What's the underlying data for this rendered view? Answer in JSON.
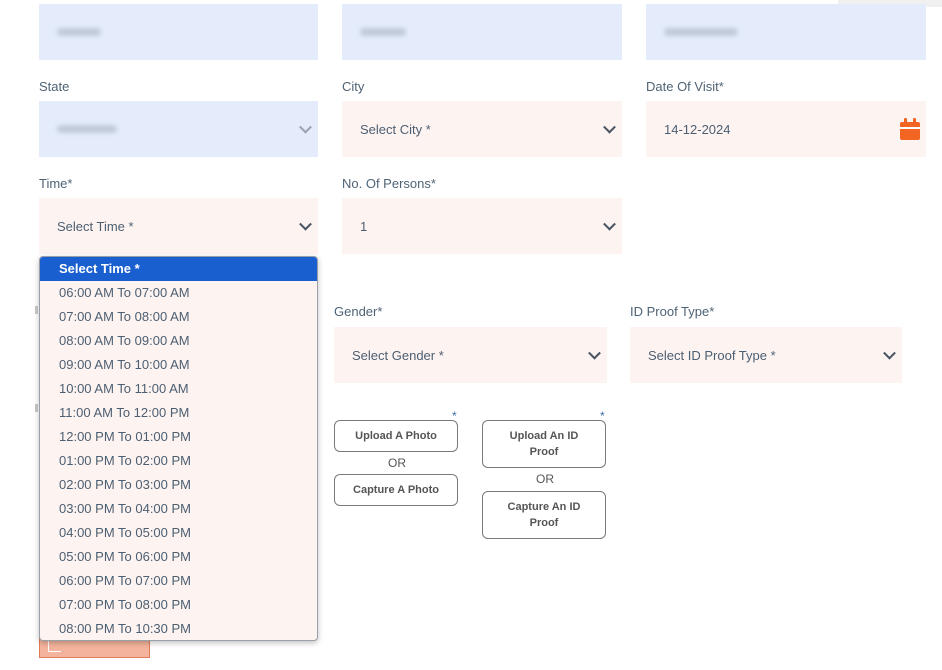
{
  "top_row": {
    "fields": [
      {
        "value": ""
      },
      {
        "value": ""
      },
      {
        "value": ""
      }
    ]
  },
  "labels": {
    "state": "State",
    "city": "City",
    "date_of_visit": "Date Of Visit*",
    "time": "Time*",
    "persons": "No. Of Persons*",
    "gender": "Gender*",
    "id_proof_type": "ID Proof Type*"
  },
  "fields": {
    "state_value": "",
    "city_value": "Select City *",
    "date_value": "14-12-2024",
    "time_value": "Select Time *",
    "persons_value": "1",
    "gender_value": "Select Gender *",
    "id_proof_value": "Select ID Proof Type *"
  },
  "uploads": {
    "photo_star": "*",
    "upload_photo": "Upload A Photo",
    "or_1": "OR",
    "capture_photo": "Capture A Photo",
    "id_star": "*",
    "upload_id": "Upload An ID Proof",
    "or_2": "OR",
    "capture_id": "Capture An ID Proof"
  },
  "time_options": [
    "Select Time *",
    "06:00 AM To 07:00 AM",
    "07:00 AM To 08:00 AM",
    "08:00 AM To 09:00 AM",
    "09:00 AM To 10:00 AM",
    "10:00 AM To 11:00 AM",
    "11:00 AM To 12:00 PM",
    "12:00 PM To 01:00 PM",
    "01:00 PM To 02:00 PM",
    "02:00 PM To 03:00 PM",
    "03:00 PM To 04:00 PM",
    "04:00 PM To 05:00 PM",
    "05:00 PM To 06:00 PM",
    "06:00 PM To 07:00 PM",
    "07:00 PM To 08:00 PM",
    "08:00 PM To 10:30 PM"
  ],
  "selected_time_index": 0,
  "icons": {
    "calendar": "calendar-icon",
    "chevron": "chevron-down-icon"
  },
  "colors": {
    "accent_blue": "#1a5fd0",
    "calendar_orange": "#f26522",
    "field_pink": "#fdf3f1",
    "field_blue": "#e4ecfb"
  }
}
